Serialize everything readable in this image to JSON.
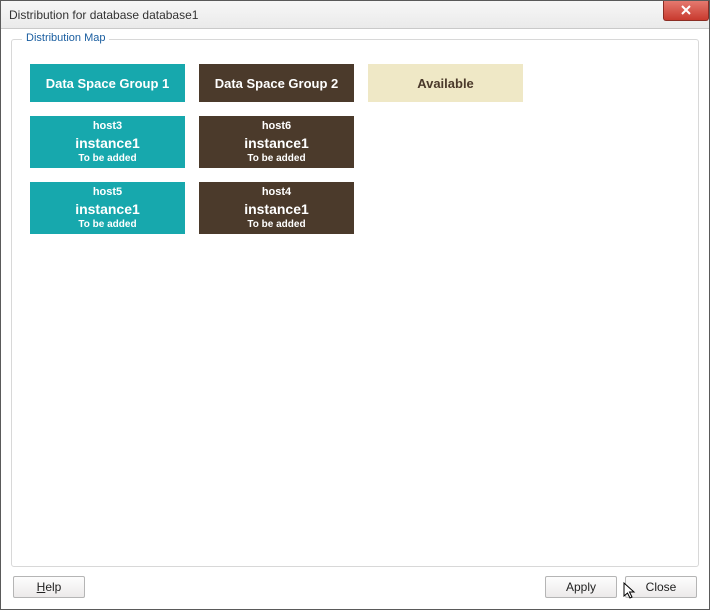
{
  "window": {
    "title": "Distribution for database database1"
  },
  "groupbox": {
    "label": "Distribution Map"
  },
  "columns": [
    {
      "label": "Data Space Group 1",
      "style": "teal"
    },
    {
      "label": "Data Space Group 2",
      "style": "brown"
    },
    {
      "label": "Available",
      "style": "avail"
    }
  ],
  "instances": {
    "r0c0": {
      "host": "host3",
      "instance": "instance1",
      "status": "To be added"
    },
    "r0c1": {
      "host": "host6",
      "instance": "instance1",
      "status": "To be added"
    },
    "r1c0": {
      "host": "host5",
      "instance": "instance1",
      "status": "To be added"
    },
    "r1c1": {
      "host": "host4",
      "instance": "instance1",
      "status": "To be added"
    }
  },
  "buttons": {
    "help": "Help",
    "apply": "Apply",
    "close": "Close"
  }
}
